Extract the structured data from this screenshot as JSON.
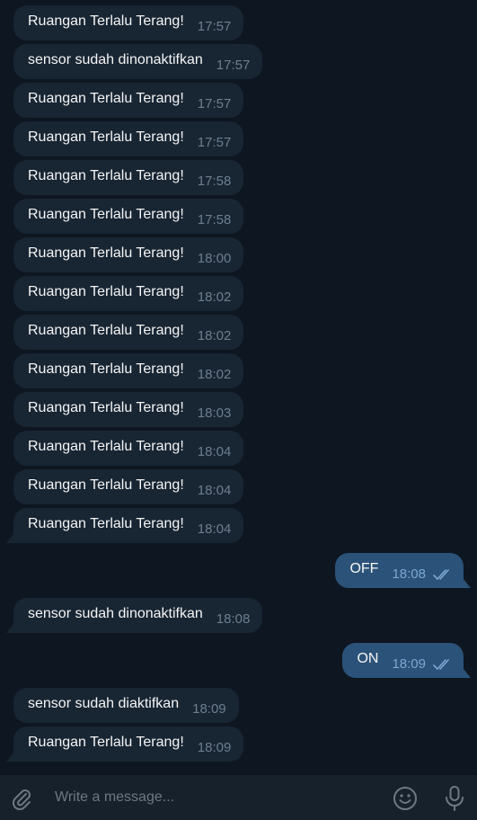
{
  "messages": [
    {
      "dir": "in",
      "text": "Ruangan Terlalu Terang!",
      "time": "17:57"
    },
    {
      "dir": "in",
      "text": "sensor sudah dinonaktifkan",
      "time": "17:57"
    },
    {
      "dir": "in",
      "text": "Ruangan Terlalu Terang!",
      "time": "17:57"
    },
    {
      "dir": "in",
      "text": "Ruangan Terlalu Terang!",
      "time": "17:57"
    },
    {
      "dir": "in",
      "text": "Ruangan Terlalu Terang!",
      "time": "17:58"
    },
    {
      "dir": "in",
      "text": "Ruangan Terlalu Terang!",
      "time": "17:58"
    },
    {
      "dir": "in",
      "text": "Ruangan Terlalu Terang!",
      "time": "18:00"
    },
    {
      "dir": "in",
      "text": "Ruangan Terlalu Terang!",
      "time": "18:02"
    },
    {
      "dir": "in",
      "text": "Ruangan Terlalu Terang!",
      "time": "18:02"
    },
    {
      "dir": "in",
      "text": "Ruangan Terlalu Terang!",
      "time": "18:02"
    },
    {
      "dir": "in",
      "text": "Ruangan Terlalu Terang!",
      "time": "18:03"
    },
    {
      "dir": "in",
      "text": "Ruangan Terlalu Terang!",
      "time": "18:04"
    },
    {
      "dir": "in",
      "text": "Ruangan Terlalu Terang!",
      "time": "18:04"
    },
    {
      "dir": "in",
      "text": "Ruangan Terlalu Terang!",
      "time": "18:04"
    },
    {
      "dir": "out",
      "text": "OFF",
      "time": "18:08",
      "read": true
    },
    {
      "dir": "in",
      "text": "sensor sudah dinonaktifkan",
      "time": "18:08"
    },
    {
      "dir": "out",
      "text": "ON",
      "time": "18:09",
      "read": true
    },
    {
      "dir": "in",
      "text": "sensor sudah diaktifkan",
      "time": "18:09"
    },
    {
      "dir": "in",
      "text": "Ruangan Terlalu Terang!",
      "time": "18:09"
    }
  ],
  "composer": {
    "placeholder": "Write a message...",
    "icons": {
      "attach": "paperclip-icon",
      "emoji": "emoji-icon",
      "mic": "microphone-icon"
    }
  },
  "colors": {
    "background": "#0e1621",
    "incoming_bubble": "#182533",
    "outgoing_bubble": "#2b5278",
    "composer_bar": "#17212b",
    "read_ticks": "#7da8d3"
  }
}
